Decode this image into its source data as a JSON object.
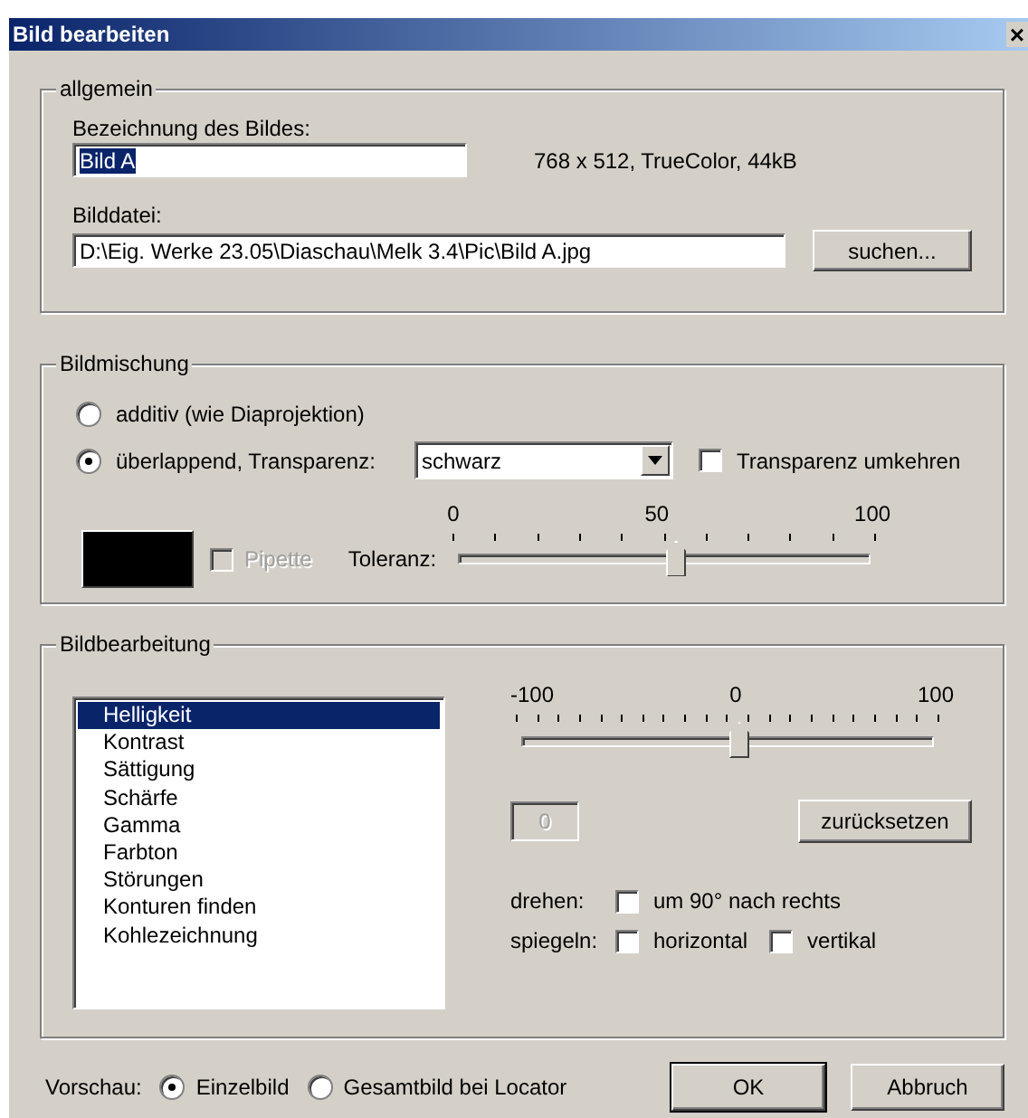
{
  "window": {
    "title": "Bild bearbeiten",
    "close": "×"
  },
  "general": {
    "title": "allgemein",
    "name_label": "Bezeichnung des Bildes:",
    "name_value": "Bild A",
    "name_selected": true,
    "info": "768 x 512, TrueColor, 44kB",
    "file_label": "Bilddatei:",
    "file_value": "D:\\Eig. Werke 23.05\\Diaschau\\Melk 3.4\\Pic\\Bild A.jpg",
    "browse_button": "suchen..."
  },
  "blending": {
    "title": "Bildmischung",
    "modes": [
      {
        "label": "additiv (wie Diaprojektion)",
        "selected": false
      },
      {
        "label": "überlappend, Transparenz:",
        "selected": true
      }
    ],
    "transparency": {
      "value": "schwarz"
    },
    "invert": {
      "label": "Transparenz umkehren",
      "checked": false
    },
    "pipette": {
      "label": "Pipette",
      "checked": false,
      "disabled": true
    },
    "tolerance": {
      "label": "Toleranz:",
      "scale": [
        "0",
        "50",
        "100"
      ],
      "level": 0.5
    }
  },
  "editing": {
    "title": "Bildbearbeitung",
    "filters": [
      {
        "label": "Helligkeit",
        "selected": true
      },
      {
        "label": "Kontrast",
        "selected": false
      },
      {
        "label": "Sättigung",
        "selected": false
      },
      {
        "label": "Schärfe",
        "selected": false
      },
      {
        "label": "Gamma",
        "selected": false
      },
      {
        "label": "Farbton",
        "selected": false
      },
      {
        "label": "Störungen",
        "selected": false
      },
      {
        "label": "Konturen finden",
        "selected": false
      },
      {
        "label": "Kohlezeichnung",
        "selected": false
      }
    ],
    "slider": {
      "scale": [
        "-100",
        "0",
        "100"
      ],
      "level": 0.5
    },
    "value_field": {
      "value": "0",
      "disabled": true
    },
    "reset_button": "zurücksetzen",
    "rotate": {
      "label": "drehen:",
      "options": [
        {
          "label": "um 90° nach rechts",
          "checked": false
        }
      ]
    },
    "mirror": {
      "label": "spiegeln:",
      "options": [
        {
          "label": "horizontal",
          "checked": false
        },
        {
          "label": "vertikal",
          "checked": false
        }
      ]
    }
  },
  "footer": {
    "preview_label": "Vorschau:",
    "preview_modes": [
      {
        "label": "Einzelbild",
        "selected": true
      },
      {
        "label": "Gesamtbild bei Locator",
        "selected": false
      }
    ],
    "buttons": [
      {
        "label": "OK",
        "default": true
      },
      {
        "label": "Abbruch",
        "default": false
      }
    ]
  }
}
